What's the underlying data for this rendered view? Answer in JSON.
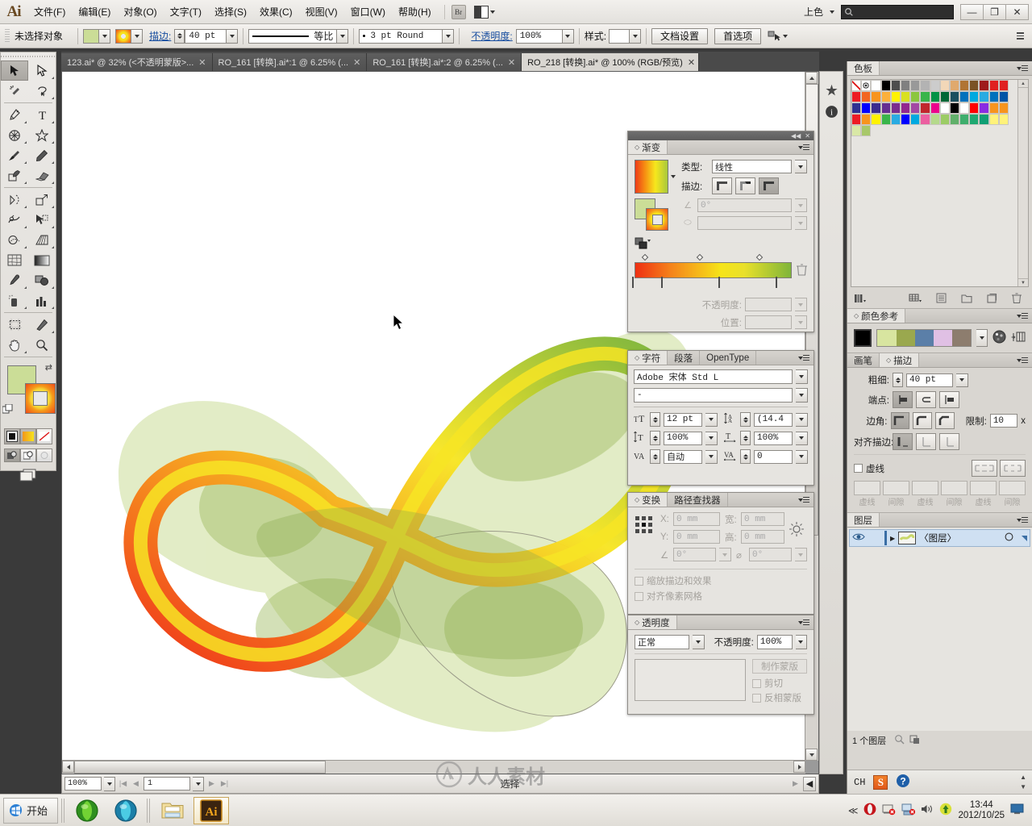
{
  "menubar": {
    "app_name": "Ai",
    "items": [
      "文件(F)",
      "编辑(E)",
      "对象(O)",
      "文字(T)",
      "选择(S)",
      "效果(C)",
      "视图(V)",
      "窗口(W)",
      "帮助(H)"
    ],
    "bridge_label": "Br",
    "workspace_label": "上色",
    "search_placeholder": "",
    "search_value": "",
    "window_buttons": {
      "minimize": "—",
      "restore": "❐",
      "close": "✕"
    }
  },
  "controlbar": {
    "selection_status": "未选择对象",
    "fill_color": "#cbdd97",
    "stroke_label": "描边:",
    "stroke_weight": "40 pt",
    "profile_label": "等比",
    "brush_label": "3 pt Round",
    "opacity_label": "不透明度:",
    "opacity_value": "100%",
    "style_label": "样式:",
    "doc_setup_button": "文档设置",
    "preferences_button": "首选项"
  },
  "tabs": [
    {
      "title": "123.ai* @ 32% (<不透明蒙版>...",
      "active": false
    },
    {
      "title": "RO_161 [转换].ai*:1 @ 6.25% (...",
      "active": false
    },
    {
      "title": "RO_161 [转换].ai*:2 @ 6.25% (...",
      "active": false
    },
    {
      "title": "RO_218 [转换].ai* @ 100% (RGB/预览)",
      "active": true
    }
  ],
  "statusbar": {
    "zoom": "100%",
    "page": "1",
    "tool_status": "选择"
  },
  "toolbar": {
    "tools": [
      "selection-tool",
      "direct-selection-tool",
      "magic-wand-tool",
      "lasso-tool",
      "pen-tool",
      "type-tool",
      "line-segment-tool",
      "shape-tool",
      "paintbrush-tool",
      "pencil-tool",
      "blob-brush-tool",
      "eraser-tool",
      "rotate-tool",
      "scale-tool",
      "width-tool",
      "free-transform-tool",
      "shape-builder-tool",
      "perspective-grid-tool",
      "mesh-tool",
      "gradient-tool",
      "eyedropper-tool",
      "blend-tool",
      "symbol-sprayer-tool",
      "column-graph-tool",
      "artboard-tool",
      "slice-tool",
      "hand-tool",
      "zoom-tool"
    ],
    "fill_color": "#cbdd97",
    "stroke_is_gradient": true
  },
  "panels": {
    "gradient": {
      "tab": "渐变",
      "type_label": "类型:",
      "type_value": "线性",
      "stroke_label": "描边:",
      "angle_value": "0°",
      "aspect_value": "",
      "opacity_label": "不透明度:",
      "opacity_value": "",
      "location_label": "位置:",
      "location_value": "",
      "stops": [
        {
          "position": 0,
          "color": "#ee2f12"
        },
        {
          "position": 28,
          "color": "#f5921a"
        },
        {
          "position": 60,
          "color": "#f5e03a"
        },
        {
          "position": 100,
          "color": "#8dc63f"
        }
      ],
      "midpoints": [
        7,
        42,
        82
      ]
    },
    "character": {
      "tabs": [
        "字符",
        "段落",
        "OpenType"
      ],
      "active_tab": "字符",
      "font_family": "Adobe 宋体 Std L",
      "font_style": "-",
      "font_size": "12 pt",
      "leading": "(14.4",
      "vertical_scale": "100%",
      "horizontal_scale": "100%",
      "kerning": "自动",
      "tracking": "0"
    },
    "transform": {
      "tabs": [
        "变换",
        "路径查找器"
      ],
      "active_tab": "变换",
      "x_label": "X:",
      "x_value": "0 mm",
      "y_label": "Y:",
      "y_value": "0 mm",
      "w_label": "宽:",
      "w_value": "0 mm",
      "h_label": "高:",
      "h_value": "0 mm",
      "rotate_value": "0°",
      "shear_value": "0°",
      "scale_strokes_label": "缩放描边和效果",
      "align_pixel_label": "对齐像素网格"
    },
    "transparency": {
      "tab": "透明度",
      "blend_mode": "正常",
      "opacity_label": "不透明度:",
      "opacity_value": "100%",
      "make_mask_button": "制作蒙版",
      "clip_label": "剪切",
      "invert_label": "反相蒙版"
    },
    "swatches": {
      "tab": "色板",
      "rows": [
        [
          "none",
          "registration",
          "#ffffff",
          "#000000",
          "#4d4d4d",
          "#808080",
          "#999999",
          "#b3b3b3",
          "#cccccc",
          "#f2d7b8",
          "#e0a96d",
          "#b07433",
          "#7a5225",
          "#9e1b1b",
          "#e02020",
          "#e02020"
        ],
        [
          "#ed1c24",
          "#f26522",
          "#f7941e",
          "#fbb03b",
          "#fff200",
          "#d9e021",
          "#8cc63f",
          "#39b54a",
          "#009245",
          "#006837",
          "#1b4f5e",
          "#0071bc",
          "#00a9e0",
          "#29abe2",
          "#0071bc",
          "#0054a6"
        ],
        [
          "#2e3192",
          "#0000ff",
          "#3b2c8f",
          "#662d91",
          "#7b2d8e",
          "#92278f",
          "#a349a4",
          "#c1272d",
          "#ec008c",
          "#ffffff",
          "#000000",
          "#ffffff",
          "#ff0000",
          "#8a2be2",
          "#f7941e",
          "#f7941e"
        ],
        [
          "#ed1c24",
          "#f7941e",
          "#fff200",
          "#39b54a",
          "#29abe2",
          "#0000ff",
          "#00a9e0",
          "#ec5fa0",
          "#b5d98b",
          "#9ccc65",
          "#61b06a",
          "#3fae6d",
          "#1fa871",
          "#0f9e74",
          "#fff27a",
          "#fff27a"
        ],
        [
          "#d9e8a6",
          "#a8c86a"
        ]
      ]
    },
    "color_guide": {
      "tab": "颜色参考",
      "base_color": "#000000",
      "harmony": [
        "#d8e5a0",
        "#9aa84e",
        "#5b7fa8",
        "#e0c0e4",
        "#8d7d6e"
      ]
    },
    "stroke": {
      "tabs": [
        "画笔",
        "描边"
      ],
      "active_tab": "描边",
      "weight_label": "粗细:",
      "weight_value": "40 pt",
      "cap_label": "端点:",
      "corner_label": "边角:",
      "limit_label": "限制:",
      "limit_value": "10",
      "limit_unit": "x",
      "align_label": "对齐描边:",
      "dashed_label": "虚线",
      "dash_fields": [
        "虚线",
        "间隙",
        "虚线",
        "间隙",
        "虚线",
        "间隙"
      ]
    },
    "layers": {
      "tab": "图层",
      "layer_name": "〈图层〉",
      "count_text": "1 个图层"
    }
  },
  "tray": {
    "time": "13:44",
    "date": "2012/10/25"
  },
  "taskbar": {
    "start_label": "开始",
    "items": [
      "browser-green",
      "browser-blue",
      "file-explorer",
      "illustrator"
    ]
  },
  "watermark": {
    "text": "人人素材"
  },
  "icons": {
    "search": "search-icon",
    "caret_down": "chevron-down-icon",
    "hamburger": "panel-menu-icon"
  }
}
